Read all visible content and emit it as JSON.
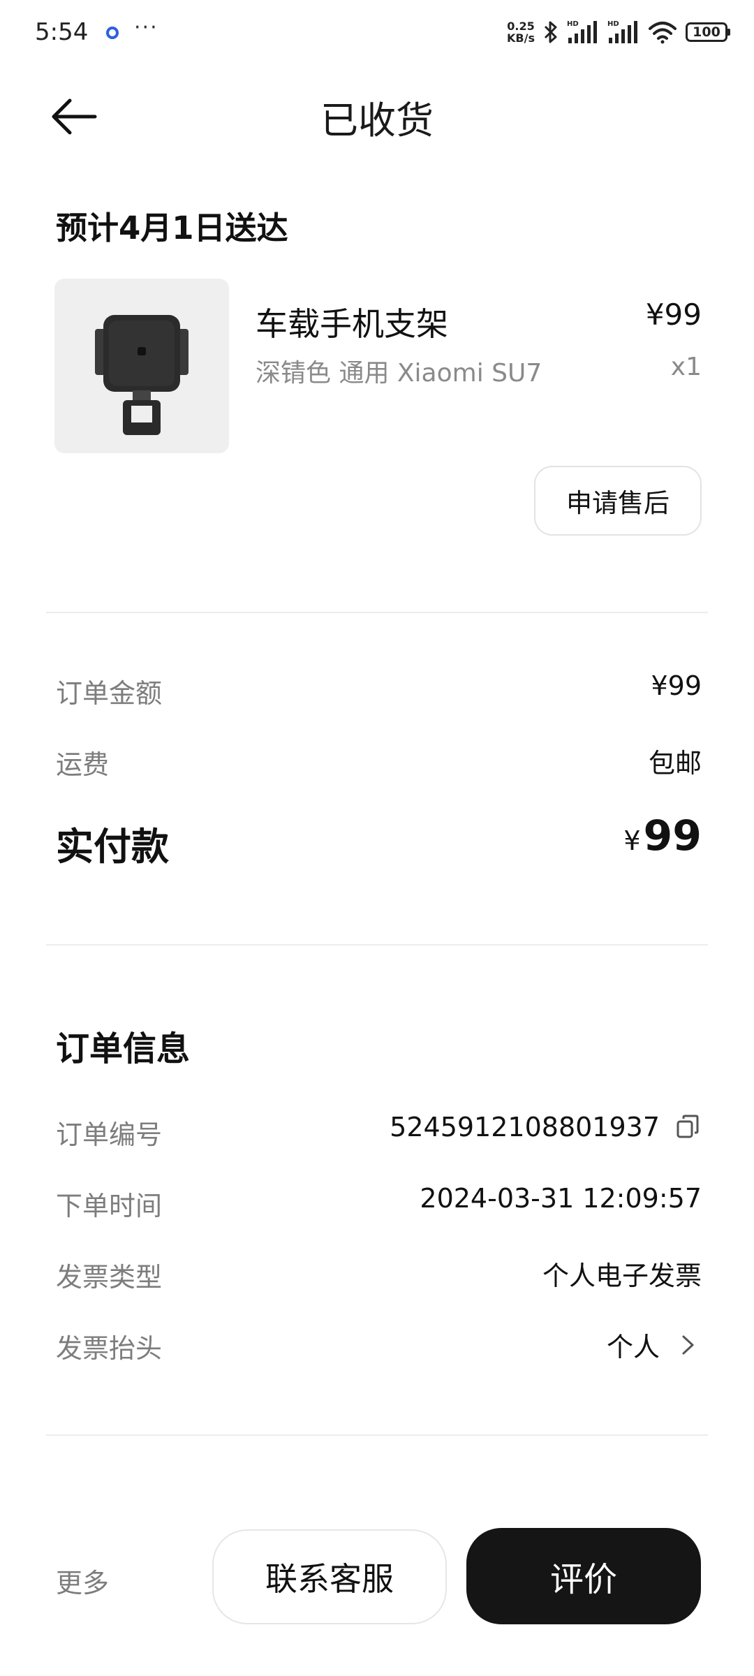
{
  "status_bar": {
    "time": "5:54",
    "more": "···",
    "net_speed_value": "0.25",
    "net_speed_unit": "KB/s",
    "battery": "100"
  },
  "header": {
    "title": "已收货"
  },
  "delivery": {
    "text": "预计4月1日送达"
  },
  "product": {
    "name": "车载手机支架",
    "price": "¥99",
    "spec": "深锖色 通用  Xiaomi SU7",
    "quantity": "x1",
    "aftersale_label": "申请售后"
  },
  "payment": {
    "order_amount_label": "订单金额",
    "order_amount_value": "¥99",
    "shipping_label": "运费",
    "shipping_value": "包邮",
    "paid_label": "实付款",
    "paid_currency": "¥",
    "paid_amount": "99"
  },
  "order_info": {
    "title": "订单信息",
    "number_label": "订单编号",
    "number_value": "5245912108801937",
    "time_label": "下单时间",
    "time_value": "2024-03-31 12:09:57",
    "invoice_type_label": "发票类型",
    "invoice_type_value": "个人电子发票",
    "invoice_title_label": "发票抬头",
    "invoice_title_value": "个人"
  },
  "bottom_bar": {
    "more_label": "更多",
    "contact_label": "联系客服",
    "review_label": "评价"
  },
  "icons": {
    "back": "arrow-left-icon",
    "copy": "copy-icon",
    "chevron": "chevron-right-icon",
    "bluetooth": "bluetooth-icon",
    "signal": "signal-icon",
    "wifi": "wifi-icon",
    "battery": "battery-icon"
  },
  "colors": {
    "primary_button": "#151515",
    "muted_text": "#7d7d7d",
    "divider": "#ececec",
    "thumb_background": "#efefef"
  }
}
